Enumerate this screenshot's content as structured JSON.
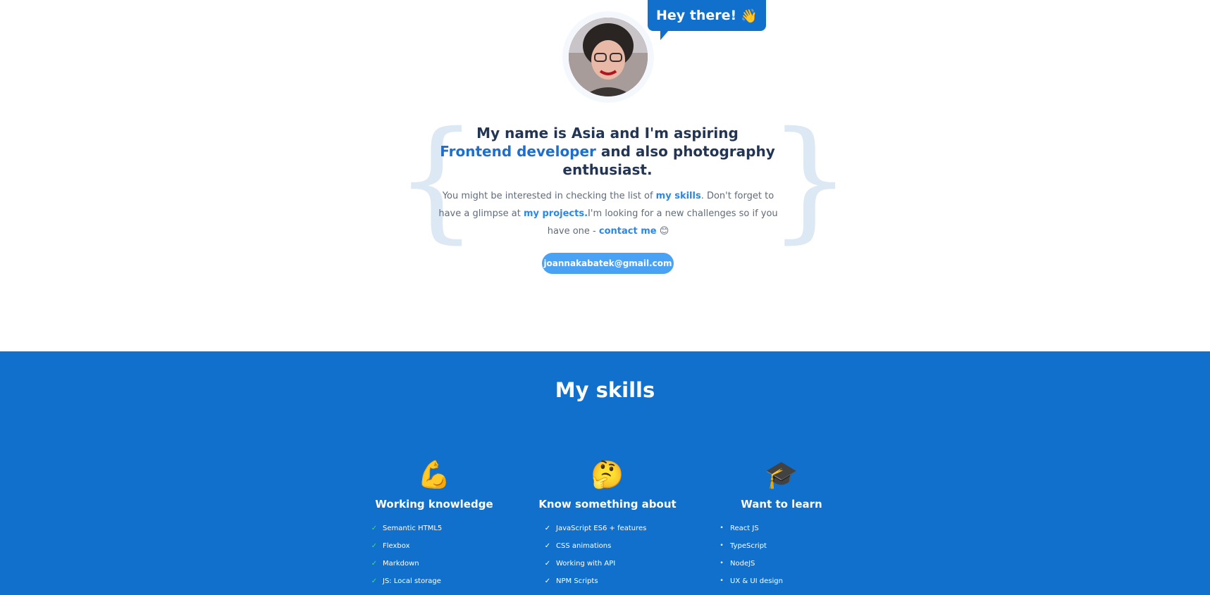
{
  "hero": {
    "bubble": {
      "text": "Hey there!",
      "emoji": "👋"
    },
    "intro": {
      "line_1": "My name is Asia and I'm aspiring",
      "accent": "Frontend developer",
      "line_2": " and also photography",
      "line_3": "enthusiast."
    },
    "description": {
      "part_1": "You might be interested in checking the list of ",
      "link_skills": "my skills",
      "part_2": ". Don't forget to have a glimpse at ",
      "link_projects": "my projects.",
      "part_3": "I'm looking for a new challenges so if you have one - ",
      "link_contact": "contact me",
      "emoji": "😊"
    },
    "email": "joannakabatek@gmail.com"
  },
  "skills": {
    "title": "My skills",
    "columns": [
      {
        "icon": "flexed-biceps-icon",
        "glyph": "💪",
        "title": "Working knowledge",
        "items": [
          "Semantic HTML5",
          "Flexbox",
          "Markdown",
          "JS: Local storage"
        ]
      },
      {
        "icon": "thinking-face-icon",
        "glyph": "🤔",
        "title": "Know something about",
        "items": [
          "JavaScript ES6 + features",
          "CSS animations",
          "Working with API",
          "NPM Scripts"
        ]
      },
      {
        "icon": "graduation-cap-icon",
        "glyph": "🎓",
        "title": "Want to learn",
        "items": [
          "React JS",
          "TypeScript",
          "NodeJS",
          "UX & UI design"
        ]
      }
    ]
  },
  "colors": {
    "primary_blue": "#1170cb",
    "accent_blue": "#1b6fd0",
    "link_blue": "#2a88e6",
    "email_button": "#49a2f3",
    "heading_text": "#233554",
    "body_text": "#606b7a",
    "brace": "#dde8f5",
    "check_green": "#3fdd83"
  }
}
